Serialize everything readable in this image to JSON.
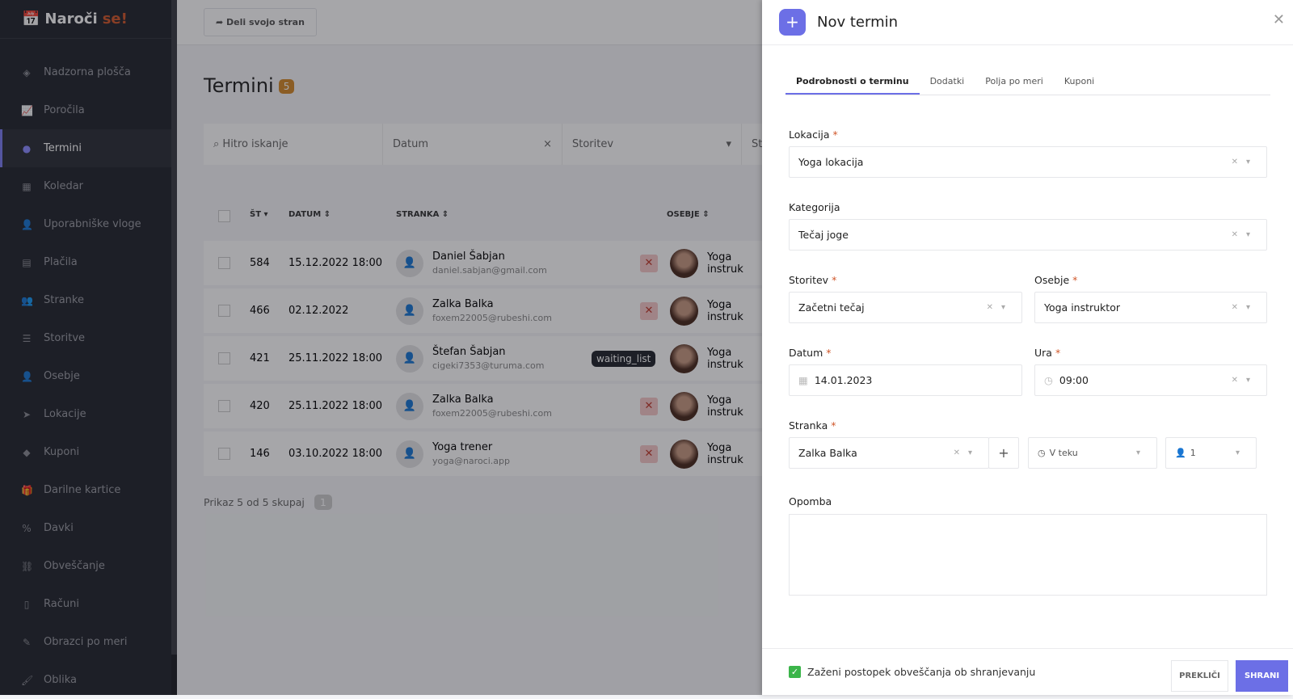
{
  "app": {
    "logo_main": "Naroči",
    "logo_accent": "se!"
  },
  "sidebar": {
    "items": [
      {
        "label": "Nadzorna plošča",
        "icon": "cube-icon",
        "glyph": "◈"
      },
      {
        "label": "Poročila",
        "icon": "chart-icon",
        "glyph": "📈"
      },
      {
        "label": "Termini",
        "icon": "clock-icon",
        "glyph": "●",
        "active": true
      },
      {
        "label": "Koledar",
        "icon": "calendar-icon",
        "glyph": "▦"
      },
      {
        "label": "Uporabniške vloge",
        "icon": "user-plus-icon",
        "glyph": "👤"
      },
      {
        "label": "Plačila",
        "icon": "payment-icon",
        "glyph": "▤"
      },
      {
        "label": "Stranke",
        "icon": "users-icon",
        "glyph": "👥"
      },
      {
        "label": "Storitve",
        "icon": "list-icon",
        "glyph": "☰"
      },
      {
        "label": "Osebje",
        "icon": "user-icon",
        "glyph": "👤"
      },
      {
        "label": "Lokacije",
        "icon": "location-arrow-icon",
        "glyph": "➤"
      },
      {
        "label": "Kuponi",
        "icon": "tag-icon",
        "glyph": "◆"
      },
      {
        "label": "Darilne kartice",
        "icon": "gift-icon",
        "glyph": "🎁"
      },
      {
        "label": "Davki",
        "icon": "percent-icon",
        "glyph": "%"
      },
      {
        "label": "Obveščanje",
        "icon": "sitemap-icon",
        "glyph": "⛓"
      },
      {
        "label": "Računi",
        "icon": "invoice-icon",
        "glyph": "▯"
      },
      {
        "label": "Obrazci po meri",
        "icon": "magic-icon",
        "glyph": "✎"
      },
      {
        "label": "Oblika",
        "icon": "brush-icon",
        "glyph": "🖌"
      }
    ]
  },
  "topbar": {
    "share_label": "Deli svojo stran"
  },
  "page": {
    "title": "Termini",
    "count": "5",
    "filters": {
      "search_placeholder": "Hitro iskanje",
      "date": "Datum",
      "service": "Storitev",
      "more": "St"
    },
    "columns": [
      "ŠT",
      "DATUM",
      "STRANKA",
      "OSEBJE"
    ],
    "rows": [
      {
        "id": "584",
        "date": "15.12.2022 18:00",
        "name": "Daniel Šabjan",
        "email": "daniel.sabjan@gmail.com",
        "status": "x",
        "staff": "Yoga instruk"
      },
      {
        "id": "466",
        "date": "02.12.2022",
        "name": "Zalka Balka",
        "email": "foxem22005@rubeshi.com",
        "status": "x",
        "staff": "Yoga instruk"
      },
      {
        "id": "421",
        "date": "25.11.2022 18:00",
        "name": "Štefan Šabjan",
        "email": "cigeki7353@turuma.com",
        "status": "waiting_list",
        "staff": "Yoga instruk"
      },
      {
        "id": "420",
        "date": "25.11.2022 18:00",
        "name": "Zalka Balka",
        "email": "foxem22005@rubeshi.com",
        "status": "x",
        "staff": "Yoga instruk"
      },
      {
        "id": "146",
        "date": "03.10.2022 18:00",
        "name": "Yoga trener",
        "email": "yoga@naroci.app",
        "status": "x",
        "staff": "Yoga instruk"
      }
    ],
    "pagination": {
      "summary": "Prikaz 5 od 5 skupaj",
      "page": "1"
    }
  },
  "panel": {
    "title": "Nov termin",
    "tabs": [
      "Podrobnosti o terminu",
      "Dodatki",
      "Polja po meri",
      "Kuponi"
    ],
    "fields": {
      "location": {
        "label": "Lokacija",
        "value": "Yoga lokacija"
      },
      "category": {
        "label": "Kategorija",
        "value": "Tečaj joge"
      },
      "service": {
        "label": "Storitev",
        "value": "Začetni tečaj"
      },
      "staff": {
        "label": "Osebje",
        "value": "Yoga instruktor"
      },
      "date": {
        "label": "Datum",
        "value": "14.01.2023"
      },
      "time": {
        "label": "Ura",
        "value": "09:00"
      },
      "customer": {
        "label": "Stranka",
        "value": "Zalka Balka",
        "status": "V teku",
        "persons": "1"
      },
      "note": {
        "label": "Opomba",
        "value": ""
      }
    },
    "notify_label": "Zaženi postopek obveščanja ob shranjevanju",
    "cancel_label": "PREKLIČI",
    "save_label": "SHRANI"
  },
  "colors": {
    "accent": "#6c6fe6",
    "brand": "#d0572a",
    "success": "#3bb54a"
  }
}
